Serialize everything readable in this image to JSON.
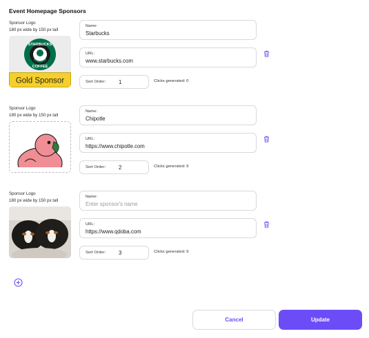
{
  "page": {
    "section_title": "Event Homepage Sponsors"
  },
  "sponsors": [
    {
      "logo_caption_line1": "Sponsor Logo",
      "logo_caption_line2": "180 px wide by 150 px tall",
      "logo_image": "starbucks-gold-sponsor-logo",
      "logo_text_brand": "STARBUCKS COFFEE",
      "logo_text_badge": "Gold Sponsor",
      "name_label": "Name:",
      "name_value": "Starbucks",
      "url_label": "URL:",
      "url_value": "www.starbucks.com",
      "order_label": "Sort Order:",
      "order_value": "1",
      "clicks": "Clicks generated: 0"
    },
    {
      "logo_caption_line1": "Sponsor Logo",
      "logo_caption_line2": "180 px wide by 150 px tall",
      "logo_image": "pink-parrot-illustration",
      "name_label": "Name:",
      "name_value": "Chipotle",
      "url_label": "URL:",
      "url_value": "https://www.chipotle.com",
      "order_label": "Sort Order:",
      "order_value": "2",
      "clicks": "Clicks generated: 9"
    },
    {
      "logo_caption_line1": "Sponsor Logo",
      "logo_caption_line2": "180 px wide by 150 px tall",
      "logo_image": "puppies-photo",
      "name_label": "Name:",
      "name_value": "",
      "name_placeholder": "Enter sponsor's name",
      "url_label": "URL:",
      "url_value": "https://www.qdoba.com",
      "order_label": "Sort Order:",
      "order_value": "3",
      "clicks": "Clicks generated: 9"
    }
  ],
  "actions": {
    "cancel_label": "Cancel",
    "update_label": "Update"
  },
  "icons": {
    "delete": "trash-icon",
    "add": "plus-circle-icon"
  },
  "colors": {
    "accent": "#6b4cf6",
    "border": "#d9d9de",
    "badge_yellow": "#f5cf2b",
    "starbucks_green": "#00704a"
  }
}
